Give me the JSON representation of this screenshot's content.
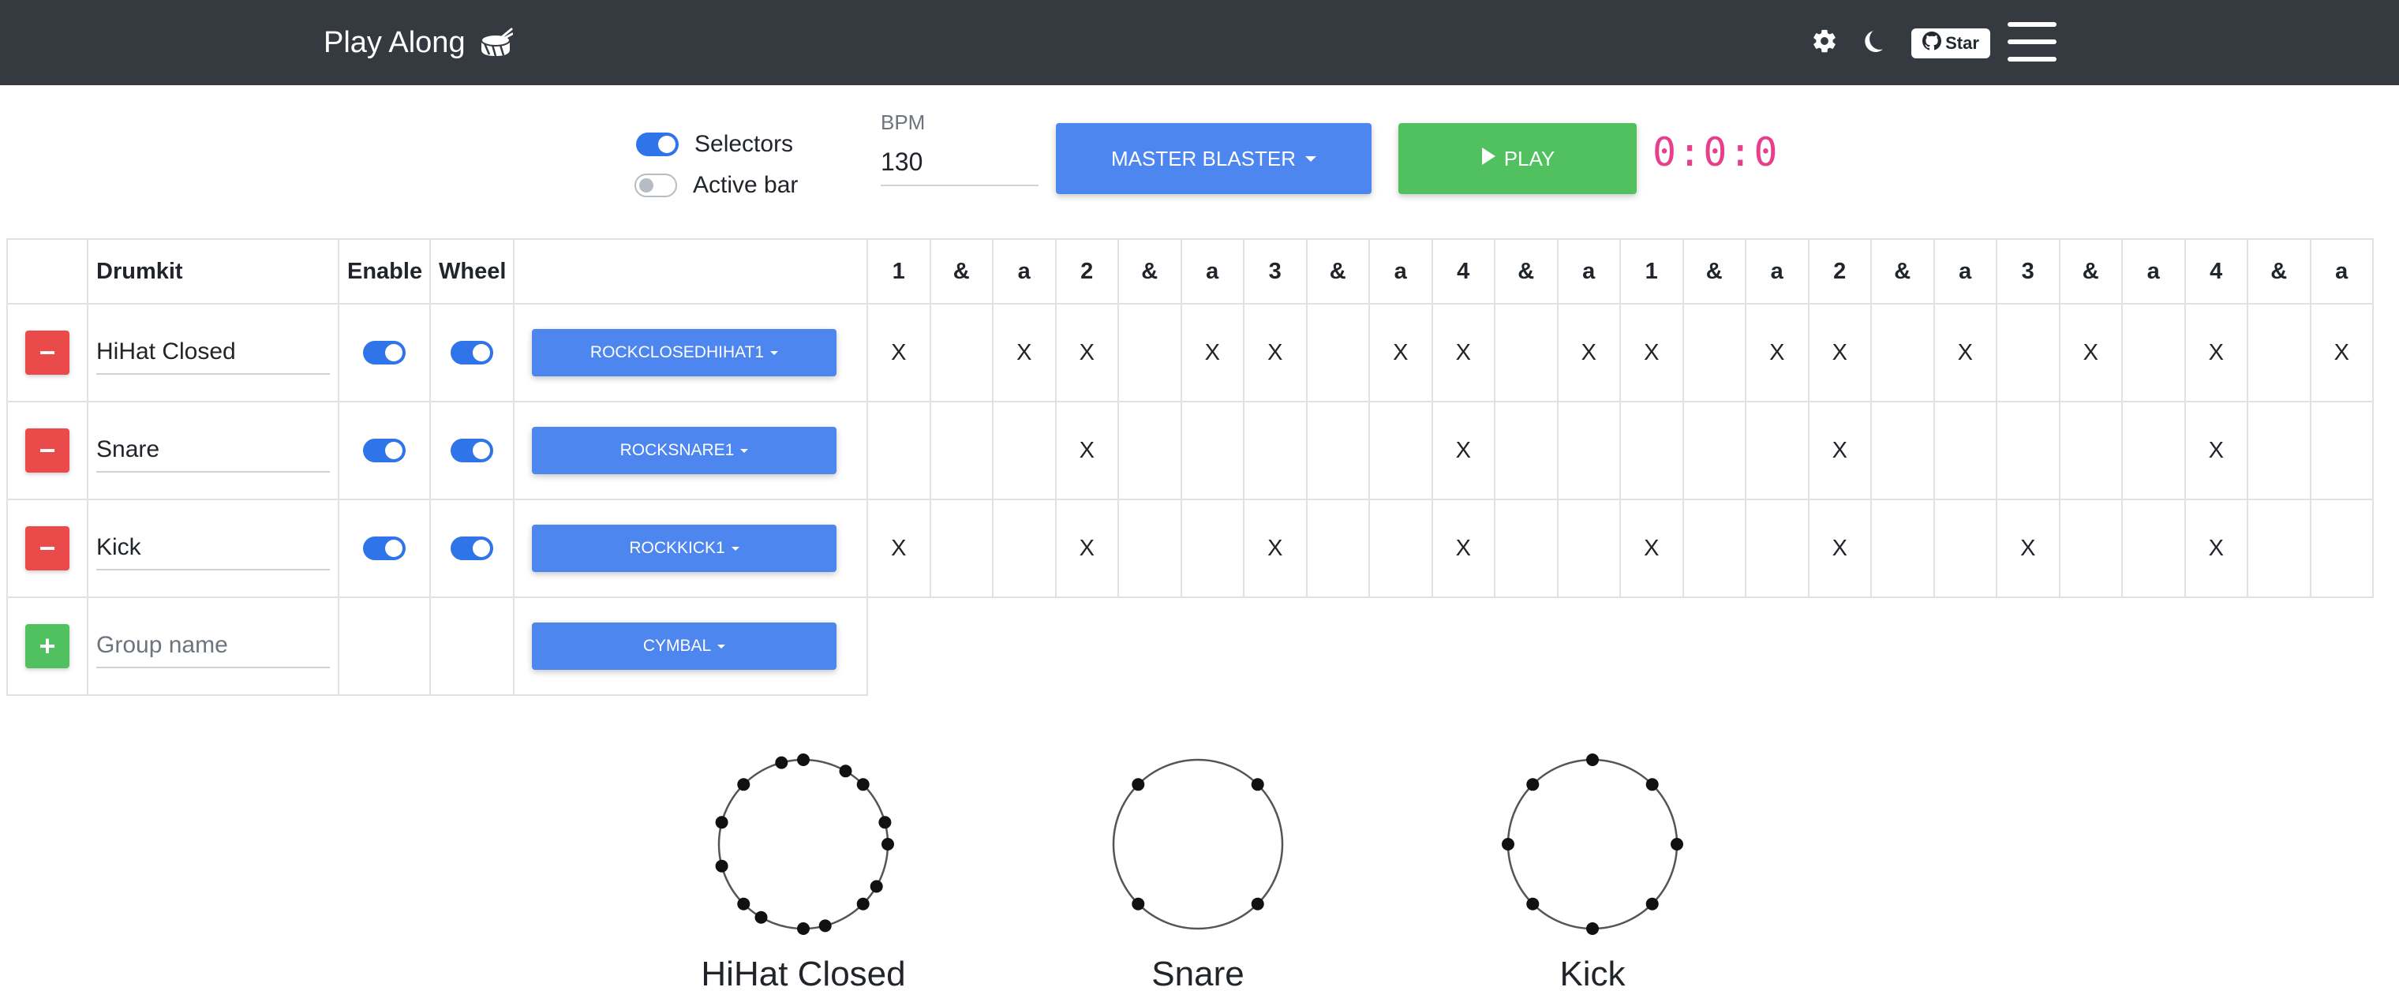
{
  "navbar": {
    "brand": "Play Along",
    "icons": [
      "drum-icon",
      "gear-icon",
      "moon-icon",
      "github-icon",
      "hamburger-icon"
    ],
    "github_label": "Star"
  },
  "controls": {
    "selectors_label": "Selectors",
    "selectors_on": true,
    "active_bar_label": "Active bar",
    "active_bar_on": false,
    "bpm_label": "BPM",
    "bpm_value": "130",
    "kit_label": "MASTER BLASTER",
    "play_label": "PLAY",
    "timer": "0:0:0"
  },
  "colors": {
    "navbar": "#343a40",
    "primary": "#4d86ee",
    "success": "#50c15e",
    "danger": "#eb4a4a",
    "timer": "#e83e8c"
  },
  "table": {
    "headers": {
      "drumkit": "Drumkit",
      "enable": "Enable",
      "wheel": "Wheel"
    },
    "beats": [
      "1",
      "&",
      "a",
      "2",
      "&",
      "a",
      "3",
      "&",
      "a",
      "4",
      "&",
      "a",
      "1",
      "&",
      "a",
      "2",
      "&",
      "a",
      "3",
      "&",
      "a",
      "4",
      "&",
      "a"
    ],
    "rows": [
      {
        "name": "HiHat Closed",
        "enabled": true,
        "wheel": true,
        "sound": "ROCKCLOSEDHIHAT1",
        "steps": [
          "X",
          "",
          "X",
          "X",
          "",
          "X",
          "X",
          "",
          "X",
          "X",
          "",
          "X",
          "X",
          "",
          "X",
          "X",
          "",
          "X",
          "",
          "X",
          "",
          "X",
          "",
          "X"
        ]
      },
      {
        "name": "Snare",
        "enabled": true,
        "wheel": true,
        "sound": "ROCKSNARE1",
        "steps": [
          "",
          "",
          "",
          "X",
          "",
          "",
          "",
          "",
          "",
          "X",
          "",
          "",
          "",
          "",
          "",
          "X",
          "",
          "",
          "",
          "",
          "",
          "X",
          "",
          ""
        ]
      },
      {
        "name": "Kick",
        "enabled": true,
        "wheel": true,
        "sound": "ROCKKICK1",
        "steps": [
          "X",
          "",
          "",
          "X",
          "",
          "",
          "X",
          "",
          "",
          "X",
          "",
          "",
          "X",
          "",
          "",
          "X",
          "",
          "",
          "X",
          "",
          "",
          "X",
          "",
          ""
        ]
      }
    ],
    "new_group": {
      "placeholder": "Group name",
      "sound": "CYMBAL"
    }
  },
  "wheels": [
    {
      "label": "HiHat Closed",
      "hits": [
        0,
        2,
        3,
        5,
        6,
        8,
        9,
        11,
        12,
        14,
        15,
        17,
        19,
        21,
        23
      ]
    },
    {
      "label": "Snare",
      "hits": [
        3,
        9,
        15,
        21
      ]
    },
    {
      "label": "Kick",
      "hits": [
        0,
        3,
        6,
        9,
        12,
        15,
        18,
        21
      ]
    }
  ]
}
